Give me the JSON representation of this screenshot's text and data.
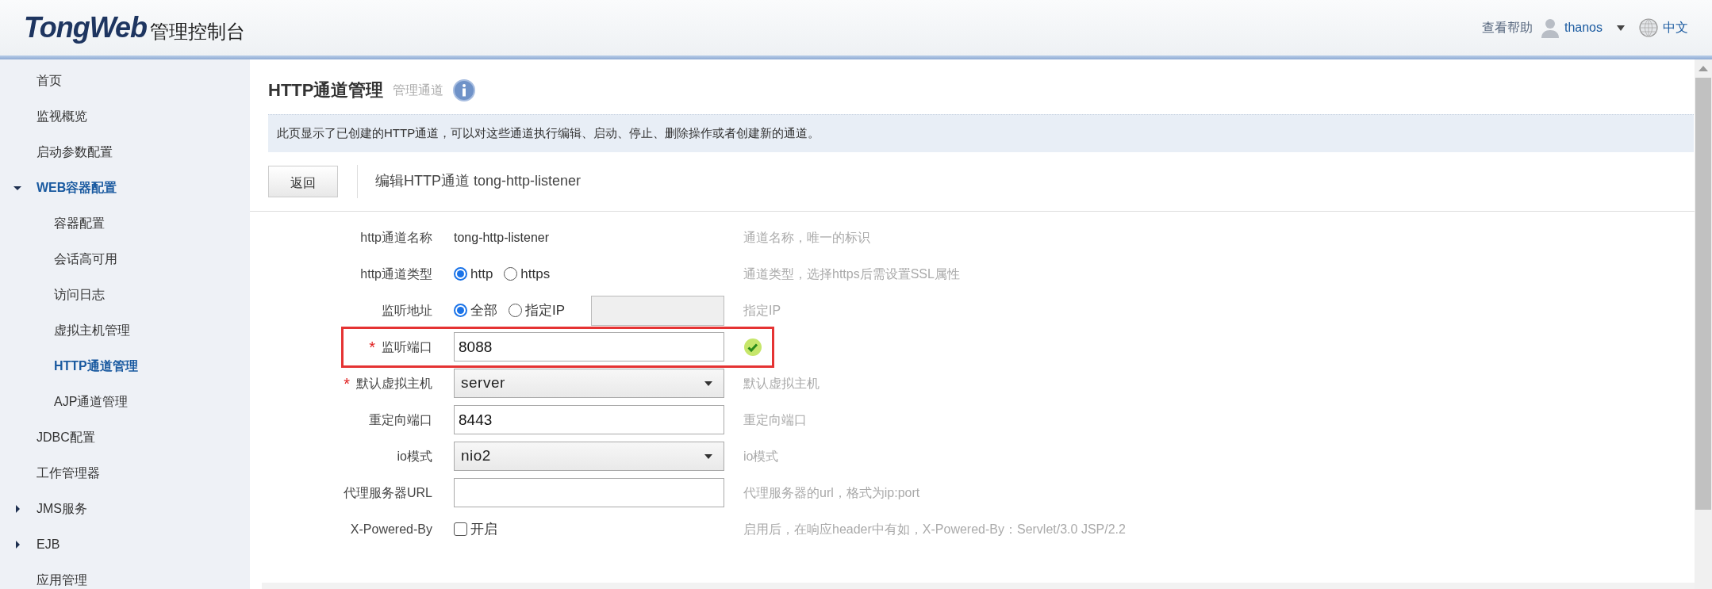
{
  "header": {
    "brand": "TongWeb",
    "product": "管理控制台",
    "help": "查看帮助",
    "user": "thanos",
    "language": "中文"
  },
  "sidebar": {
    "items": [
      {
        "label": "首页",
        "selected": false
      },
      {
        "label": "监视概览",
        "selected": false
      },
      {
        "label": "启动参数配置",
        "selected": false
      },
      {
        "label": "WEB容器配置",
        "selected": true,
        "expanded": true,
        "children": [
          {
            "label": "容器配置",
            "selected": false
          },
          {
            "label": "会话高可用",
            "selected": false
          },
          {
            "label": "访问日志",
            "selected": false
          },
          {
            "label": "虚拟主机管理",
            "selected": false
          },
          {
            "label": "HTTP通道管理",
            "selected": true
          },
          {
            "label": "AJP通道管理",
            "selected": false
          }
        ]
      },
      {
        "label": "JDBC配置",
        "selected": false
      },
      {
        "label": "工作管理器",
        "selected": false
      },
      {
        "label": "JMS服务",
        "selected": false,
        "expanded": false
      },
      {
        "label": "EJB",
        "selected": false,
        "expanded": false
      },
      {
        "label": "应用管理",
        "selected": false
      }
    ]
  },
  "page": {
    "title": "HTTP通道管理",
    "subtitle": "管理通道",
    "info": "此页显示了已创建的HTTP通道，可以对这些通道执行编辑、启动、停止、删除操作或者创建新的通道。",
    "back_button": "返回",
    "edit_title": "编辑HTTP通道 tong-http-listener"
  },
  "form": {
    "rows": [
      {
        "kind": "text",
        "label": "http通道名称",
        "highlighted": false,
        "valid": false,
        "value": "tong-http-listener",
        "hint": "通道名称，唯一的标识"
      },
      {
        "kind": "radio",
        "label": "http通道类型",
        "highlighted": false,
        "valid": false,
        "options": [
          {
            "label": "http",
            "selected": true
          },
          {
            "label": "https",
            "selected": false
          }
        ],
        "hint": "通道类型，选择https后需设置SSL属性"
      },
      {
        "kind": "radio",
        "label": "监听地址",
        "highlighted": false,
        "valid": false,
        "options": [
          {
            "label": "全部",
            "selected": true
          },
          {
            "label": "指定IP",
            "selected": false
          }
        ],
        "ip_field": {
          "disabled": true
        },
        "hint": "指定IP"
      },
      {
        "kind": "input",
        "label": "监听端口",
        "required_mark": "*",
        "highlighted": true,
        "valid": true,
        "value": "8088"
      },
      {
        "kind": "select",
        "label": "默认虚拟主机",
        "required_mark": "*",
        "highlighted": false,
        "valid": false,
        "value": "server",
        "hint": "默认虚拟主机"
      },
      {
        "kind": "input",
        "label": "重定向端口",
        "highlighted": false,
        "valid": false,
        "value": "8443",
        "hint": "重定向端口"
      },
      {
        "kind": "select",
        "label": "io模式",
        "highlighted": false,
        "valid": false,
        "value": "nio2",
        "hint": "io模式"
      },
      {
        "kind": "input",
        "label": "代理服务器URL",
        "highlighted": false,
        "valid": false,
        "value": "",
        "hint": "代理服务器的url，格式为ip:port"
      },
      {
        "kind": "checkbox",
        "label": "X-Powered-By",
        "highlighted": false,
        "valid": false,
        "checked": false,
        "option": "开启",
        "hint": "启用后，在响应header中有如，X-Powered-By：Servlet/3.0 JSP/2.2"
      }
    ]
  }
}
